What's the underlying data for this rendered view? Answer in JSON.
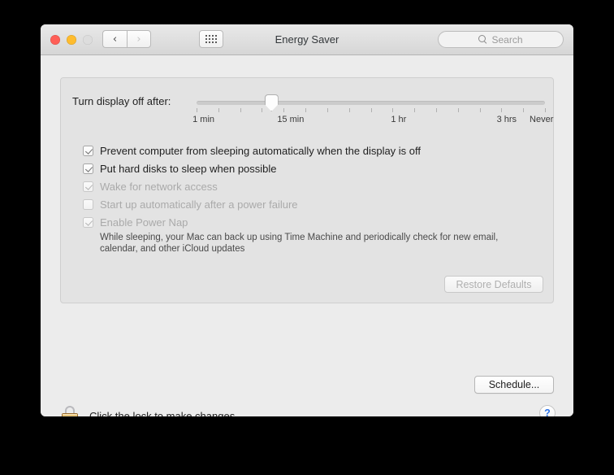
{
  "window": {
    "title": "Energy Saver",
    "traffic_lights": [
      "close",
      "minimize",
      "zoom"
    ]
  },
  "toolbar": {
    "back_glyph": "‹",
    "forward_glyph": "›",
    "grid_icon": "show-all-icon",
    "search": {
      "icon": "search-icon",
      "placeholder": "Search",
      "value": ""
    }
  },
  "slider": {
    "label": "Turn display off after:",
    "value_label": "15 min",
    "thumb_percent": 21.5,
    "tick_count": 17,
    "tick_labels": [
      {
        "text": "1 min",
        "percent": 2
      },
      {
        "text": "15 min",
        "percent": 27
      },
      {
        "text": "1 hr",
        "percent": 58
      },
      {
        "text": "3 hrs",
        "percent": 89
      },
      {
        "text": "Never",
        "percent": 99
      }
    ]
  },
  "checkboxes": [
    {
      "label": "Prevent computer from sleeping automatically when the display is off",
      "checked": true,
      "enabled": true
    },
    {
      "label": "Put hard disks to sleep when possible",
      "checked": true,
      "enabled": true
    },
    {
      "label": "Wake for network access",
      "checked": true,
      "enabled": false
    },
    {
      "label": "Start up automatically after a power failure",
      "checked": false,
      "enabled": false
    },
    {
      "label": "Enable Power Nap",
      "checked": true,
      "enabled": false
    }
  ],
  "power_nap_description": "While sleeping, your Mac can back up using Time Machine and periodically check for new email, calendar, and other iCloud updates",
  "buttons": {
    "restore_defaults": "Restore Defaults",
    "restore_defaults_enabled": false,
    "schedule": "Schedule...",
    "help": "?"
  },
  "lock": {
    "icon": "lock-closed-icon",
    "text": "Click the lock to make changes."
  },
  "colors": {
    "window_bg": "#ececec",
    "panel_bg": "#e3e3e3",
    "accent_blue": "#2b72e8",
    "lock_gold": "#e8b548",
    "disabled_text": "#aaaaaa"
  }
}
